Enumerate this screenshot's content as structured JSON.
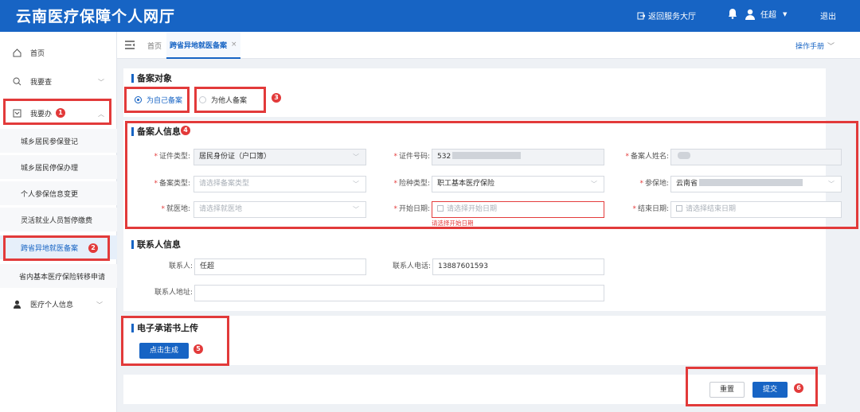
{
  "header": {
    "title": "云南医疗保障个人网厅",
    "back_label": "返回服务大厅",
    "user_name": "任超",
    "logout_label": "退出"
  },
  "sidebar": {
    "home": "首页",
    "query": "我要查",
    "handle": "我要办",
    "sub_items": [
      "城乡居民参保登记",
      "城乡居民停保办理",
      "个人参保信息变更",
      "灵活就业人员暂停缴费",
      "跨省异地就医备案",
      "省内基本医疗保险转移申请"
    ],
    "personal": "医疗个人信息"
  },
  "tabs": {
    "home": "首页",
    "active": "跨省异地就医备案",
    "close": "×",
    "manual": "操作手册"
  },
  "target": {
    "title": "备案对象",
    "self": "为自己备案",
    "other": "为他人备案"
  },
  "info": {
    "title": "备案人信息",
    "id_type_label": "证件类型:",
    "id_type_value": "居民身份证（户口簿）",
    "id_no_label": "证件号码:",
    "id_no_prefix": "532",
    "name_label": "备案人姓名:",
    "record_type_label": "备案类型:",
    "record_type_ph": "请选择备案类型",
    "insurance_type_label": "险种类型:",
    "insurance_type_value": "职工基本医疗保险",
    "insured_place_label": "参保地:",
    "insured_place_value": "云南省",
    "medical_place_label": "就医地:",
    "medical_place_ph": "请选择就医地",
    "start_label": "开始日期:",
    "start_ph": "请选择开始日期",
    "start_error": "请选择开始日期",
    "end_label": "结束日期:",
    "end_ph": "请选择结束日期"
  },
  "contact": {
    "title": "联系人信息",
    "name_label": "联系人:",
    "name_value": "任超",
    "phone_label": "联系人电话:",
    "phone_value": "13887601593",
    "address_label": "联系人地址:",
    "address_value": ""
  },
  "upload": {
    "title": "电子承诺书上传",
    "generate_label": "点击生成"
  },
  "actions": {
    "reset": "重置",
    "submit": "提交"
  },
  "badges": [
    "1",
    "2",
    "3",
    "4",
    "5",
    "6"
  ],
  "colors": {
    "primary": "#1764c4",
    "annotation": "#e23a3a"
  }
}
